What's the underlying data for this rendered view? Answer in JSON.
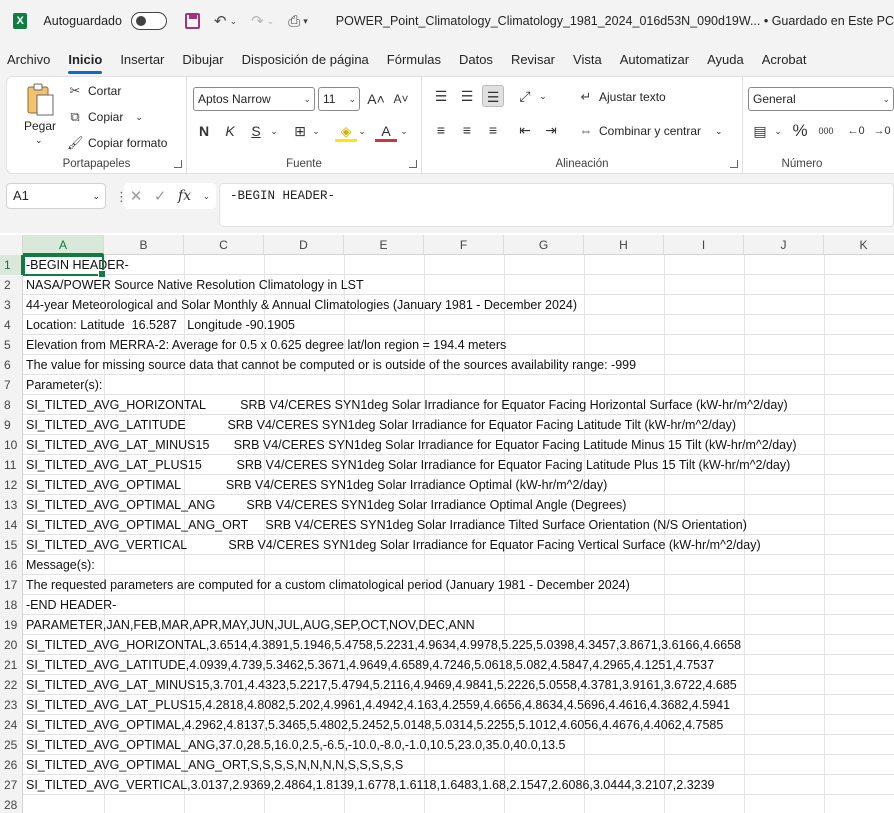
{
  "titlebar": {
    "autosave_label": "Autoguardado",
    "document_title": "POWER_Point_Climatology_Climatology_1981_2024_016d53N_090d19W...  •  Guardado en Este PC"
  },
  "menu": {
    "tabs": [
      "Archivo",
      "Inicio",
      "Insertar",
      "Dibujar",
      "Disposición de página",
      "Fórmulas",
      "Datos",
      "Revisar",
      "Vista",
      "Automatizar",
      "Ayuda",
      "Acrobat"
    ],
    "active": "Inicio"
  },
  "ribbon": {
    "portapapeles": {
      "label": "Portapapeles",
      "paste": "Pegar",
      "cut": "Cortar",
      "copy": "Copiar",
      "format_painter": "Copiar formato"
    },
    "fuente": {
      "label": "Fuente",
      "font_name": "Aptos Narrow",
      "font_size": "11",
      "bold": "N",
      "italic": "K",
      "underline": "S",
      "grow": "A",
      "shrink": "A"
    },
    "alineacion": {
      "label": "Alineación",
      "wrap_text": "Ajustar texto",
      "merge_center": "Combinar y centrar"
    },
    "numero": {
      "label": "Número",
      "format": "General",
      "percent": "%",
      "thousands": "000"
    }
  },
  "formula_bar": {
    "name_box": "A1",
    "fx": "fx",
    "formula": "-BEGIN HEADER-"
  },
  "grid": {
    "columns": [
      "A",
      "B",
      "C",
      "D",
      "E",
      "F",
      "G",
      "H",
      "I",
      "J",
      "K"
    ],
    "active_column": "A",
    "active_row": 1,
    "rows": [
      {
        "num": "1",
        "a": "-BEGIN HEADER-"
      },
      {
        "num": "2",
        "a": "NASA/POWER Source Native Resolution Climatology in LST"
      },
      {
        "num": "3",
        "a": "44-year Meteorological and Solar Monthly & Annual Climatologies (January 1981 - December 2024)"
      },
      {
        "num": "4",
        "a": "Location: Latitude  16.5287   Longitude -90.1905"
      },
      {
        "num": "5",
        "a": "Elevation from MERRA-2: Average for 0.5 x 0.625 degree lat/lon region = 194.4 meters"
      },
      {
        "num": "6",
        "a": "The value for missing source data that cannot be computed or is outside of the sources availability range: -999"
      },
      {
        "num": "7",
        "a": "Parameter(s):"
      },
      {
        "num": "8",
        "a": "SI_TILTED_AVG_HORIZONTAL          SRB V4/CERES SYN1deg Solar Irradiance for Equator Facing Horizontal Surface (kW-hr/m^2/day)"
      },
      {
        "num": "9",
        "a": "SI_TILTED_AVG_LATITUDE            SRB V4/CERES SYN1deg Solar Irradiance for Equator Facing Latitude Tilt (kW-hr/m^2/day)"
      },
      {
        "num": "10",
        "a": "SI_TILTED_AVG_LAT_MINUS15       SRB V4/CERES SYN1deg Solar Irradiance for Equator Facing Latitude Minus 15 Tilt (kW-hr/m^2/day)"
      },
      {
        "num": "11",
        "a": "SI_TILTED_AVG_LAT_PLUS15          SRB V4/CERES SYN1deg Solar Irradiance for Equator Facing Latitude Plus 15 Tilt (kW-hr/m^2/day)"
      },
      {
        "num": "12",
        "a": "SI_TILTED_AVG_OPTIMAL             SRB V4/CERES SYN1deg Solar Irradiance Optimal (kW-hr/m^2/day)"
      },
      {
        "num": "13",
        "a": "SI_TILTED_AVG_OPTIMAL_ANG         SRB V4/CERES SYN1deg Solar Irradiance Optimal Angle (Degrees)"
      },
      {
        "num": "14",
        "a": "SI_TILTED_AVG_OPTIMAL_ANG_ORT     SRB V4/CERES SYN1deg Solar Irradiance Tilted Surface Orientation (N/S Orientation)"
      },
      {
        "num": "15",
        "a": "SI_TILTED_AVG_VERTICAL            SRB V4/CERES SYN1deg Solar Irradiance for Equator Facing Vertical Surface (kW-hr/m^2/day)"
      },
      {
        "num": "16",
        "a": "Message(s):"
      },
      {
        "num": "17",
        "a": "The requested parameters are computed for a custom climatological period (January 1981 - December 2024)"
      },
      {
        "num": "18",
        "a": "-END HEADER-"
      },
      {
        "num": "19",
        "a": "PARAMETER,JAN,FEB,MAR,APR,MAY,JUN,JUL,AUG,SEP,OCT,NOV,DEC,ANN"
      },
      {
        "num": "20",
        "a": "SI_TILTED_AVG_HORIZONTAL,3.6514,4.3891,5.1946,5.4758,5.2231,4.9634,4.9978,5.225,5.0398,4.3457,3.8671,3.6166,4.6658"
      },
      {
        "num": "21",
        "a": "SI_TILTED_AVG_LATITUDE,4.0939,4.739,5.3462,5.3671,4.9649,4.6589,4.7246,5.0618,5.082,4.5847,4.2965,4.1251,4.7537"
      },
      {
        "num": "22",
        "a": "SI_TILTED_AVG_LAT_MINUS15,3.701,4.4323,5.2217,5.4794,5.2116,4.9469,4.9841,5.2226,5.0558,4.3781,3.9161,3.6722,4.685"
      },
      {
        "num": "23",
        "a": "SI_TILTED_AVG_LAT_PLUS15,4.2818,4.8082,5.202,4.9961,4.4942,4.163,4.2559,4.6656,4.8634,4.5696,4.4616,4.3682,4.5941"
      },
      {
        "num": "24",
        "a": "SI_TILTED_AVG_OPTIMAL,4.2962,4.8137,5.3465,5.4802,5.2452,5.0148,5.0314,5.2255,5.1012,4.6056,4.4676,4.4062,4.7585"
      },
      {
        "num": "25",
        "a": "SI_TILTED_AVG_OPTIMAL_ANG,37.0,28.5,16.0,2.5,-6.5,-10.0,-8.0,-1.0,10.5,23.0,35.0,40.0,13.5"
      },
      {
        "num": "26",
        "a": "SI_TILTED_AVG_OPTIMAL_ANG_ORT,S,S,S,S,N,N,N,N,S,S,S,S,S"
      },
      {
        "num": "27",
        "a": "SI_TILTED_AVG_VERTICAL,3.0137,2.9369,2.4864,1.8139,1.6778,1.6118,1.6483,1.68,2.1547,2.6086,3.0444,3.2107,2.3239"
      },
      {
        "num": "28",
        "a": ""
      }
    ]
  },
  "colors": {
    "excel_green": "#107c41",
    "accent_blue": "#0f6cbd",
    "chrome_bg": "#f3f3f3"
  }
}
